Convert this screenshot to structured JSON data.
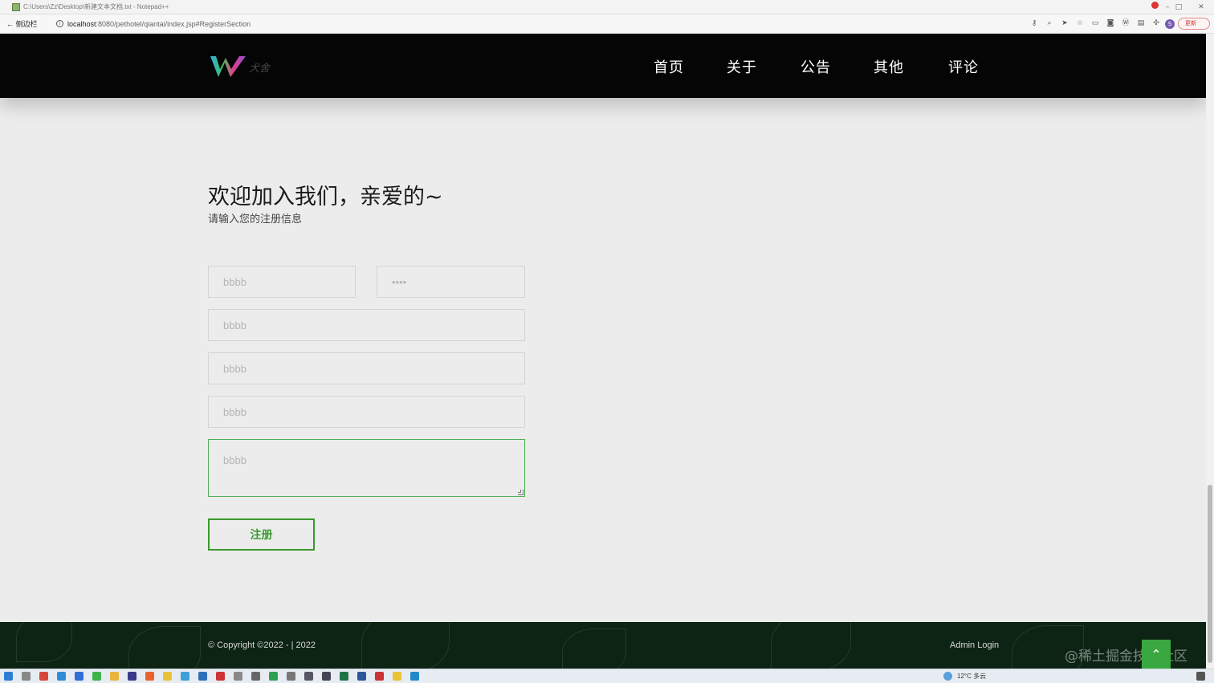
{
  "window": {
    "title": "C:\\Users\\Zz\\Desktop\\新建文本文档.txt - Notepad++",
    "controls": [
      "–",
      "□",
      "✕"
    ]
  },
  "browser": {
    "back_label": "← 侧边栏",
    "url_host": "localhost",
    "url_path": ":8080/pethotel/qiantai/index.jsp#RegisterSection",
    "profile_initial": "S",
    "update_label": "更新"
  },
  "nav": {
    "logo_sub": "犬舍",
    "items": [
      "首页",
      "关于",
      "公告",
      "其他",
      "评论"
    ]
  },
  "register": {
    "title": "欢迎加入我们，亲爱的~",
    "subtitle": "请输入您的注册信息",
    "fields": {
      "username": "bbbb",
      "password": "••••",
      "field3": "bbbb",
      "field4": "bbbb",
      "field5": "bbbb",
      "message": "bbbb"
    },
    "submit_label": "注册"
  },
  "footer": {
    "copyright": "© Copyright ©2022 - | 2022",
    "admin_login": "Admin Login",
    "back_to_top": "⌃"
  },
  "watermark": "@稀土掘金技术社区",
  "taskbar": {
    "weather": "12°C 多云"
  },
  "colors": {
    "accent": "#3a9a2e",
    "navbar": "#050505",
    "footer": "#0d2414"
  }
}
